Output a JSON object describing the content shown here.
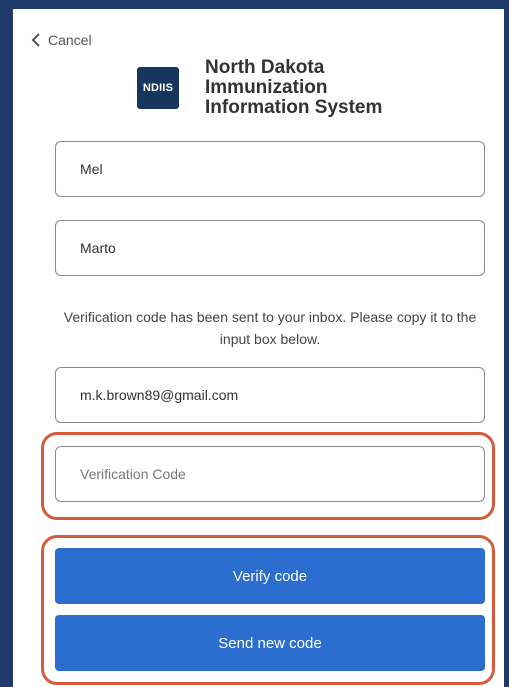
{
  "nav": {
    "cancel_label": "Cancel"
  },
  "brand": {
    "logo_text": "NDIIS",
    "title_lines": [
      "North Dakota",
      "Immunization",
      "Information System"
    ]
  },
  "form": {
    "first_name_value": "Mel",
    "last_name_value": "Marto",
    "info_text": "Verification code has been sent to your inbox. Please copy it to the input box below.",
    "email_value": "m.k.brown89@gmail.com",
    "verification_placeholder": "Verification Code",
    "verify_button_label": "Verify code",
    "send_new_button_label": "Send new code"
  },
  "colors": {
    "frame": "#1f3a6b",
    "logo_bg": "#17365d",
    "button_bg": "#2b6ecf",
    "highlight": "#d35a3b"
  }
}
